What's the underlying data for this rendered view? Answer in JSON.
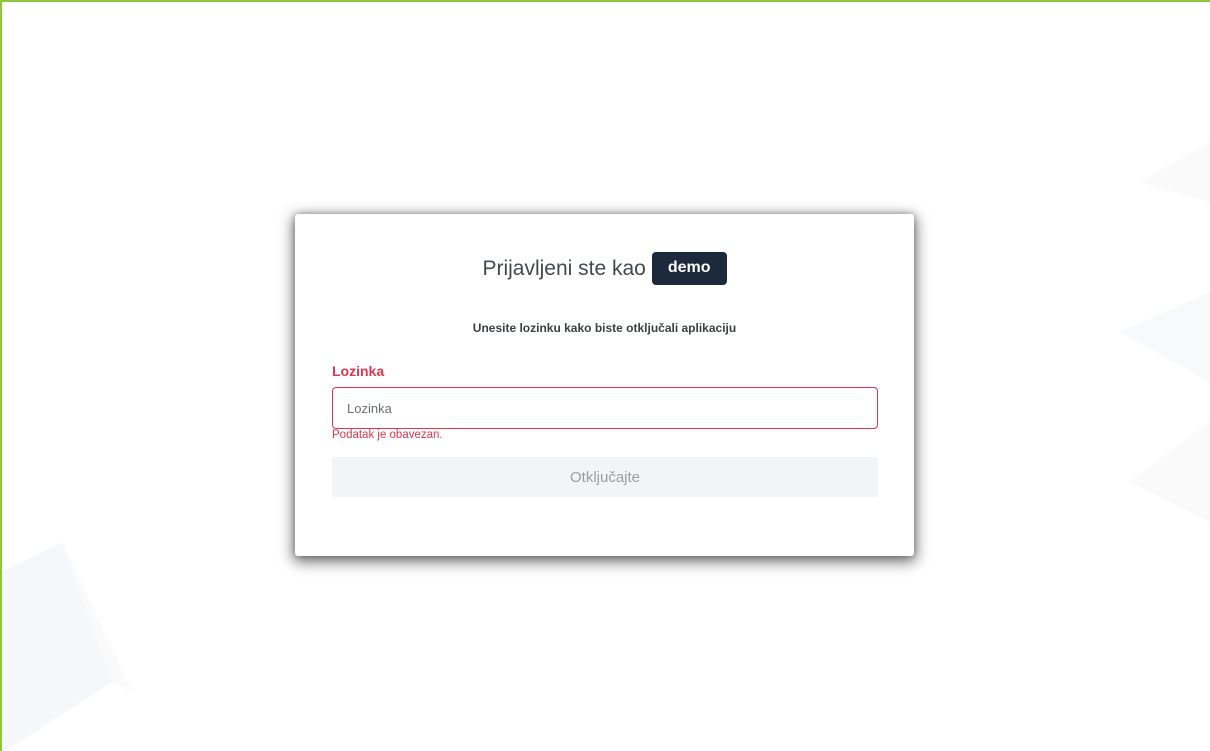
{
  "lock_screen": {
    "title": "Prijavljeni ste kao",
    "username": "demo",
    "subtitle": "Unesite lozinku kako biste otključali aplikaciju",
    "password_label": "Lozinka",
    "password_placeholder": "Lozinka",
    "password_value": "",
    "error_message": "Podatak je obavezan.",
    "unlock_button_label": "Otključajte",
    "unlock_button_disabled": true
  },
  "colors": {
    "accent_border": "#8dc63f",
    "error": "#e0364d",
    "badge_bg": "#1d2a3d",
    "button_bg": "#f3f4f6",
    "button_text": "#9a9da3"
  }
}
